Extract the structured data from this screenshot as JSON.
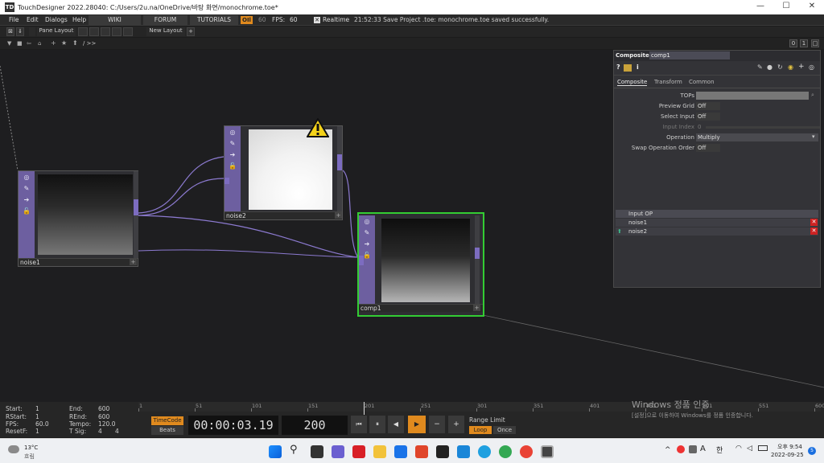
{
  "window": {
    "title": "TouchDesigner 2022.28040: C:/Users/2u.na/OneDrive/바탕 화면/monochrome.toe*",
    "logo": "TD",
    "controls": [
      "—",
      "☐",
      "✕"
    ]
  },
  "menu": {
    "items": [
      "File",
      "Edit",
      "Dialogs",
      "Help"
    ],
    "wiki": "WIKI",
    "forum": "FORUM",
    "tutorials": "TUTORIALS",
    "oil": "OIl",
    "fps_target": "60",
    "fps_label": "FPS:",
    "fps_value": "60",
    "realtime": "Realtime",
    "status": "21:52:33 Save Project .toe: monochrome.toe saved successfully."
  },
  "tabs": {
    "pane_layout": "Pane Layout",
    "new_layout": "New Layout",
    "plus": "+"
  },
  "path": {
    "current": "/ >>",
    "right": [
      "0",
      "1"
    ]
  },
  "nodes": {
    "noise1": {
      "name": "noise1",
      "plus": "+"
    },
    "noise2": {
      "name": "noise2",
      "plus": "+"
    },
    "comp1": {
      "name": "comp1",
      "plus": "+"
    }
  },
  "params": {
    "op_type": "Composite",
    "op_name": "comp1",
    "help": "?",
    "info": "i",
    "tabs": [
      "Composite",
      "Transform",
      "Common"
    ],
    "rows": [
      {
        "label": "TOPs",
        "value": ""
      },
      {
        "label": "Preview Grid",
        "value": "Off"
      },
      {
        "label": "Select Input",
        "value": "Off"
      },
      {
        "label": "Input Index",
        "value": "0"
      },
      {
        "label": "Operation",
        "value": "Multiply"
      },
      {
        "label": "Swap Operation Order",
        "value": "Off"
      }
    ],
    "input_header": "Input OP",
    "inputs": [
      "noise1",
      "noise2"
    ],
    "remove": "✕"
  },
  "timeline": {
    "start_label": "Start:",
    "start_value": "1",
    "rstart_label": "RStart:",
    "rstart_value": "1",
    "fps_label": "FPS:",
    "fps_value": "60.0",
    "resetf_label": "ResetF:",
    "resetf_value": "1",
    "end_label": "End:",
    "end_value": "600",
    "rend_label": "REnd:",
    "rend_value": "600",
    "tempo_label": "Tempo:",
    "tempo_value": "120.0",
    "tsig_label": "T Sig:",
    "tsig_a": "4",
    "tsig_b": "4",
    "timecode": "TimeCode",
    "beats": "Beats",
    "time": "00:00:03.19",
    "frame": "200",
    "range_limit": "Range Limit",
    "loop": "Loop",
    "once": "Once",
    "ticks": [
      "1",
      "51",
      "101",
      "151",
      "201",
      "251",
      "301",
      "351",
      "401",
      "451",
      "501",
      "551",
      "600"
    ],
    "play_controls": [
      "⏮",
      "⏸",
      "◀",
      "▶",
      "−",
      "+"
    ]
  },
  "watermark": {
    "line1": "Windows 정품 인증",
    "line2": "[설정]으로 이동하여 Windows를 정품 인증합니다."
  },
  "taskbar": {
    "weather_temp": "13°C",
    "weather_desc": "흐림",
    "ime_a": "A",
    "ime_han": "한",
    "time": "오후 9:54",
    "date": "2022-09-25",
    "notify": "5",
    "chevron": "^"
  },
  "colors": {
    "accent": "#7c6cc0",
    "selected": "#33cc33",
    "orange": "#e08a1e",
    "error": "#cc2222"
  }
}
